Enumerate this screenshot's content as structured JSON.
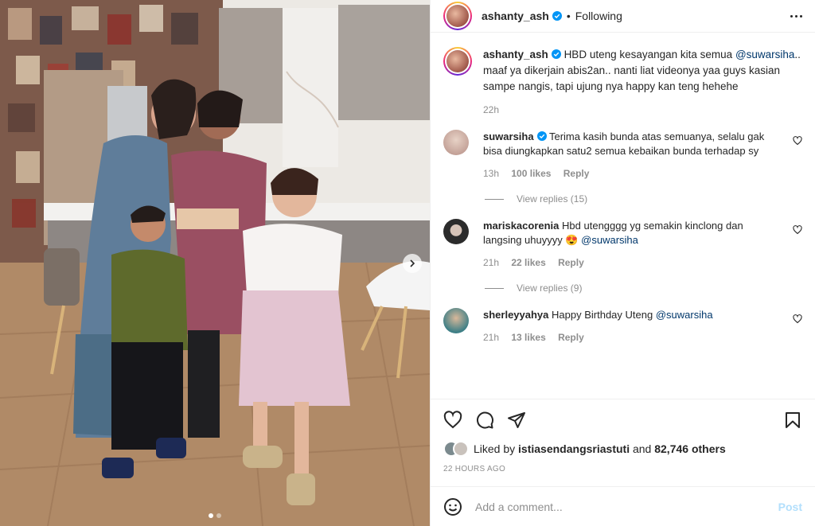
{
  "post": {
    "author": "ashanty_ash",
    "follow_status": "Following",
    "caption_text": "HBD uteng kesayangan kita semua ",
    "caption_mention": "@suwarsiha",
    "caption_rest": ".. maaf ya dikerjain abis2an.. nanti liat videonya yaa guys kasian sampe nangis, tapi ujung nya happy kan teng hehehe",
    "caption_time": "22h"
  },
  "comments": [
    {
      "user": "suwarsiha",
      "verified": true,
      "text": "Terima kasih bunda atas semuanya, selalu gak bisa diungkapkan satu2 semua kebaikan bunda terhadap sy",
      "time": "13h",
      "likes": "100 likes",
      "reply": "Reply",
      "view_replies": "View replies (15)"
    },
    {
      "user": "mariskacorenia",
      "text": "Hbd utengggg yg semakin kinclong dan langsing uhuyyyy ",
      "emoji": "😍",
      "mention": "@suwarsiha",
      "time": "21h",
      "likes": "22 likes",
      "reply": "Reply",
      "view_replies": "View replies (9)"
    },
    {
      "user": "sherleyyahya",
      "text": "Happy Birthday Uteng ",
      "mention": "@suwarsiha",
      "time": "21h",
      "likes": "13 likes",
      "reply": "Reply"
    }
  ],
  "likes_summary": {
    "prefix": "Liked by ",
    "user": "istiasendangsriastuti",
    "middle": " and ",
    "others": "82,746 others"
  },
  "time_ago": "22 HOURS AGO",
  "add_comment": {
    "placeholder": "Add a comment...",
    "post_label": "Post"
  },
  "colors": {
    "mention": "#00376b",
    "post_button": "#b2dffc",
    "muted": "#8e8e8e"
  }
}
